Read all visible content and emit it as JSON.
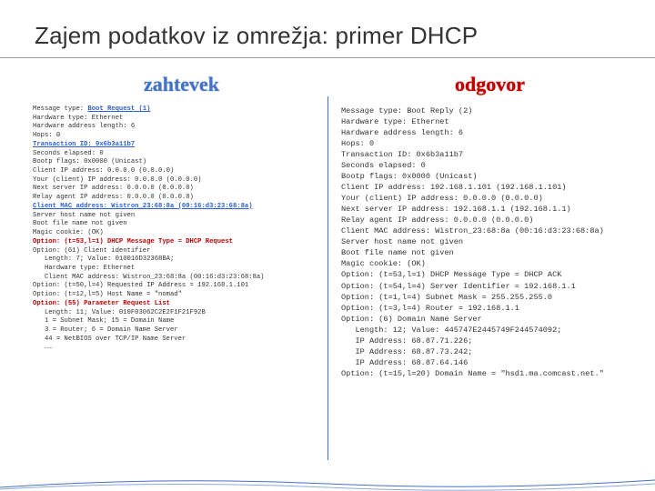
{
  "title": "Zajem podatkov iz omrežja: primer DHCP",
  "left": {
    "heading": "zahtevek",
    "lines": [
      {
        "t": "Message type: ",
        "s": "Boot Request (1)",
        "cls": "blue bold"
      },
      {
        "t": "Hardware type: Ethernet"
      },
      {
        "t": "Hardware address length: 6"
      },
      {
        "t": "Hops: 0"
      },
      {
        "t": "",
        "s": "Transaction ID: 0x6b3a11b7",
        "cls": "blue bold"
      },
      {
        "t": "Seconds elapsed: 0"
      },
      {
        "t": "Bootp flags: 0x0000 (Unicast)"
      },
      {
        "t": "Client IP address: 0.0.0.0 (0.0.0.0)"
      },
      {
        "t": "Your (client) IP address: 0.0.0.0 (0.0.0.0)"
      },
      {
        "t": "Next server IP address: 0.0.0.0 (0.0.0.0)"
      },
      {
        "t": "Relay agent IP address: 0.0.0.0 (0.0.0.0)"
      },
      {
        "t": "",
        "s": "Client MAC address: Wistron_23:68:8a (00:16:d3:23:68:8a)",
        "cls": "blue bold"
      },
      {
        "t": "Server host name not given"
      },
      {
        "t": "Boot file name not given"
      },
      {
        "t": "Magic cookie: (OK)"
      },
      {
        "t": "",
        "s": "Option: (t=53,l=1) DHCP Message Type = DHCP Request",
        "cls": "red bold"
      },
      {
        "t": "Option: (61) Client identifier"
      },
      {
        "t": "   Length: 7; Value: 010016D32368BA;"
      },
      {
        "t": "   Hardware type: Ethernet"
      },
      {
        "t": "   Client MAC address: Wistron_23:68:8a (00:16:d3:23:68:8a)"
      },
      {
        "t": "Option: (t=50,l=4) Requested IP Address = 192.168.1.101"
      },
      {
        "t": "Option: (t=12,l=5) Host Name = \"nomad\""
      },
      {
        "t": "",
        "s": "Option: (55) Parameter Request List",
        "cls": "red bold"
      },
      {
        "t": "   Length: 11; Value: 010F03062C2E2F1F21F92B"
      },
      {
        "t": "   1 = Subnet Mask; 15 = Domain Name"
      },
      {
        "t": "   3 = Router; 6 = Domain Name Server"
      },
      {
        "t": "   44 = NetBIOS over TCP/IP Name Server"
      },
      {
        "t": "   ……"
      }
    ]
  },
  "right": {
    "heading": "odgovor",
    "lines": [
      {
        "t": "Message type: Boot Reply (2)"
      },
      {
        "t": "Hardware type: Ethernet"
      },
      {
        "t": "Hardware address length: 6"
      },
      {
        "t": "Hops: 0"
      },
      {
        "t": "Transaction ID: 0x6b3a11b7"
      },
      {
        "t": "Seconds elapsed: 0"
      },
      {
        "t": "Bootp flags: 0x0000 (Unicast)"
      },
      {
        "t": "Client IP address: 192.168.1.101 (192.168.1.101)"
      },
      {
        "t": "Your (client) IP address: 0.0.0.0 (0.0.0.0)"
      },
      {
        "t": "Next server IP address: 192.168.1.1 (192.168.1.1)"
      },
      {
        "t": "Relay agent IP address: 0.0.0.0 (0.0.0.0)"
      },
      {
        "t": "Client MAC address: Wistron_23:68:8a (00:16:d3:23:68:8a)"
      },
      {
        "t": "Server host name not given"
      },
      {
        "t": "Boot file name not given"
      },
      {
        "t": "Magic cookie: (OK)"
      },
      {
        "t": "Option: (t=53,l=1) DHCP Message Type = DHCP ACK"
      },
      {
        "t": "Option: (t=54,l=4) Server Identifier = 192.168.1.1"
      },
      {
        "t": "Option: (t=1,l=4) Subnet Mask = 255.255.255.0"
      },
      {
        "t": "Option: (t=3,l=4) Router = 192.168.1.1"
      },
      {
        "t": "Option: (6) Domain Name Server"
      },
      {
        "t": "   Length: 12; Value: 445747E2445749F244574092;"
      },
      {
        "t": "   IP Address: 68.87.71.226;"
      },
      {
        "t": "   IP Address: 68.87.73.242;"
      },
      {
        "t": "   IP Address: 68.87.64.146"
      },
      {
        "t": "Option: (t=15,l=20) Domain Name = \"hsd1.ma.comcast.net.\""
      }
    ]
  }
}
